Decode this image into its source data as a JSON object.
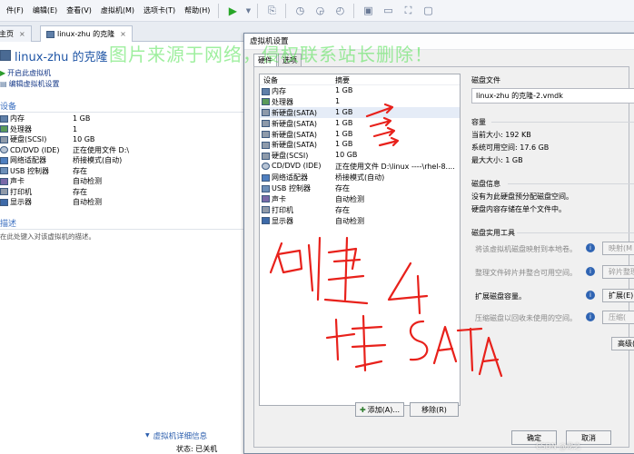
{
  "menu": [
    "件(F)",
    "编辑(E)",
    "查看(V)",
    "虚拟机(M)",
    "选项卡(T)",
    "帮助(H)"
  ],
  "tabs": [
    {
      "label": "主页"
    },
    {
      "label": "linux-zhu 的克隆"
    }
  ],
  "vm_title": "linux-zhu 的克隆",
  "actions": [
    "开启此虚拟机",
    "编辑虚拟机设置"
  ],
  "left_devices_header": "设备",
  "left_devices": [
    {
      "name": "内存",
      "value": "1 GB",
      "icon": "memory-icon"
    },
    {
      "name": "处理器",
      "value": "1",
      "icon": "cpu-icon"
    },
    {
      "name": "硬盘(SCSI)",
      "value": "10 GB",
      "icon": "disk-icon"
    },
    {
      "name": "CD/DVD (IDE)",
      "value": "正在使用文件 D:\\",
      "icon": "cdrom-icon"
    },
    {
      "name": "网络适配器",
      "value": "桥接模式(自动)",
      "icon": "network-icon"
    },
    {
      "name": "USB 控制器",
      "value": "存在",
      "icon": "usb-icon"
    },
    {
      "name": "声卡",
      "value": "自动检测",
      "icon": "sound-icon"
    },
    {
      "name": "打印机",
      "value": "存在",
      "icon": "printer-icon"
    },
    {
      "name": "显示器",
      "value": "自动检测",
      "icon": "display-icon"
    }
  ],
  "description_header": "描述",
  "description_text": "在此处键入对该虚拟机的描述。",
  "vm_details": {
    "title": "虚拟机详细信息",
    "status_label": "状态:",
    "status_value": "已关机"
  },
  "dialog": {
    "title": "虚拟机设置",
    "tabs": [
      "硬件",
      "选项"
    ],
    "col_device": "设备",
    "col_summary": "摘要",
    "devices": [
      {
        "name": "内存",
        "summary": "1 GB",
        "icon": "memory-icon"
      },
      {
        "name": "处理器",
        "summary": "1",
        "icon": "cpu-icon"
      },
      {
        "name": "新硬盘(SATA)",
        "summary": "1 GB",
        "icon": "disk-icon"
      },
      {
        "name": "新硬盘(SATA)",
        "summary": "1 GB",
        "icon": "disk-icon"
      },
      {
        "name": "新硬盘(SATA)",
        "summary": "1 GB",
        "icon": "disk-icon"
      },
      {
        "name": "新硬盘(SATA)",
        "summary": "1 GB",
        "icon": "disk-icon"
      },
      {
        "name": "硬盘(SCSI)",
        "summary": "10 GB",
        "icon": "disk-icon"
      },
      {
        "name": "CD/DVD (IDE)",
        "summary": "正在使用文件 D:\\linux ----\\rhel-8....",
        "icon": "cdrom-icon"
      },
      {
        "name": "网络适配器",
        "summary": "桥接模式(自动)",
        "icon": "network-icon"
      },
      {
        "name": "USB 控制器",
        "summary": "存在",
        "icon": "usb-icon"
      },
      {
        "name": "声卡",
        "summary": "自动检测",
        "icon": "sound-icon"
      },
      {
        "name": "打印机",
        "summary": "存在",
        "icon": "printer-icon"
      },
      {
        "name": "显示器",
        "summary": "自动检测",
        "icon": "display-icon"
      }
    ],
    "add_button": "添加(A)...",
    "remove_button": "移除(R)",
    "disk_file_label": "磁盘文件",
    "disk_file_value": "linux-zhu 的克隆-2.vmdk",
    "capacity_label": "容量",
    "current_size": "当前大小: 192 KB",
    "system_free": "系统可用空间: 17.6 GB",
    "max_size": "最大大小: 1 GB",
    "disk_info_label": "磁盘信息",
    "disk_info_line1": "没有为此硬盘预分配磁盘空间。",
    "disk_info_line2": "硬盘内容存储在单个文件中。",
    "utilities_label": "磁盘实用工具",
    "util1_text": "将该虚拟机磁盘映射到本地卷。",
    "util1_btn": "映射(M",
    "util2_text": "整理文件碎片并整合可用空间。",
    "util2_btn": "碎片整理",
    "util3_text": "扩展磁盘容量。",
    "util3_btn": "扩展(E)",
    "util4_text": "压缩磁盘以回收未使用的空间。",
    "util4_btn": "压缩(",
    "advanced_btn": "高级(",
    "ok_btn": "确定",
    "cancel_btn": "取消"
  },
  "watermark": "图片来源于网络，侵权联系站长删除！",
  "annotation_text": "创建4块SATA",
  "annotation_color": "#e8211b",
  "csdn_mark": "CSDN @龙之"
}
